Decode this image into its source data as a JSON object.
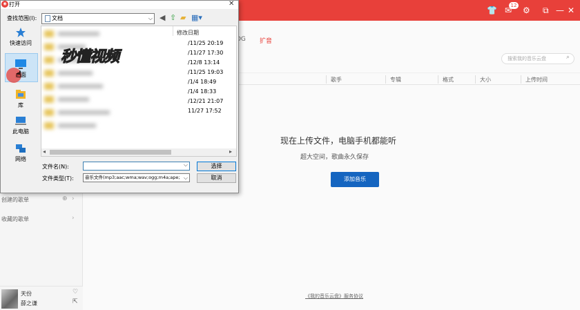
{
  "app": {
    "badge_count": "12",
    "tabs": [
      "DG",
      "扩音"
    ],
    "search_placeholder": "搜索我的音乐云盘",
    "table_headers": [
      "歌手",
      "专辑",
      "格式",
      "大小",
      "上传时间"
    ],
    "empty_title_left": "现在上传文件，电脑手机都能听",
    "empty_sub": "超大空间，歌曲永久保存",
    "add_music_label": "添加音乐",
    "agreement": "《我的音乐云盘》服务协议",
    "sidebar": {
      "created_playlists": "创建的歌单",
      "collected_playlists": "收藏的歌单"
    },
    "player": {
      "song": "天份",
      "artist": "薛之谦"
    },
    "colors": {
      "brand": "#e8403a",
      "button": "#1565c0"
    }
  },
  "dialog": {
    "title": "打开",
    "look_in_label": "查找范围(I):",
    "look_in_value": "文档",
    "places": [
      "快速访问",
      "桌面",
      "库",
      "此电脑",
      "网络"
    ],
    "date_column_header": "修改日期",
    "dates": [
      "/11/25 20:19",
      "/11/27 17:30",
      "/12/8 13:14",
      "/11/25 19:03",
      "/1/4 18:49",
      "/1/4 18:33",
      "/12/21 21:07",
      "11/27 17:52"
    ],
    "filename_label": "文件名(N):",
    "filename_value": "",
    "filetype_label": "文件类型(T):",
    "filetype_value": "音乐文件(mp3;aac;wma;wav;ogg;m4a;ape;",
    "open_button": "选择",
    "cancel_button": "取消",
    "watermark": "秒懂视频"
  }
}
